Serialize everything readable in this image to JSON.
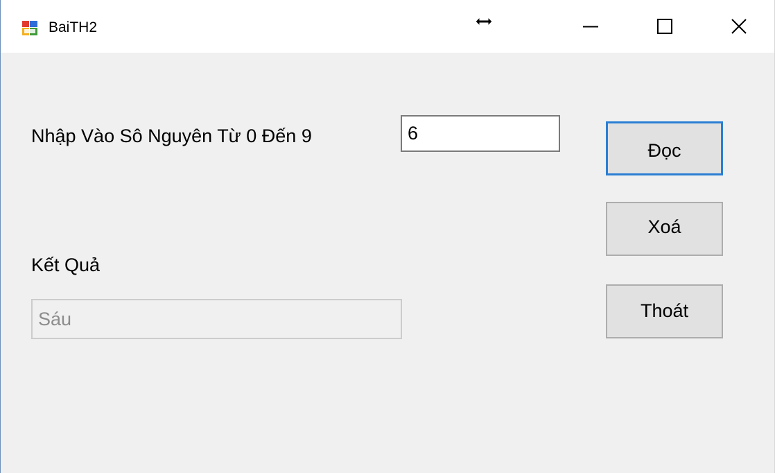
{
  "window": {
    "title": "BaiTH2",
    "app_icon": "winforms-app-icon",
    "cursor_icon": "horizontal-resize-cursor-icon",
    "controls": {
      "minimize_icon": "minimize-icon",
      "maximize_icon": "maximize-icon",
      "close_icon": "close-icon"
    }
  },
  "form": {
    "input_label": "Nhập Vào Sô Nguyên Từ 0 Đến 9",
    "input_value": "6",
    "result_label": "Kết Quả",
    "result_value": "Sáu"
  },
  "buttons": {
    "read_label": "Đọc",
    "clear_label": "Xoá",
    "exit_label": "Thoát"
  },
  "colors": {
    "focus_border": "#2a7fd4",
    "button_face": "#e1e1e1",
    "form_background": "#f0f0f0"
  }
}
